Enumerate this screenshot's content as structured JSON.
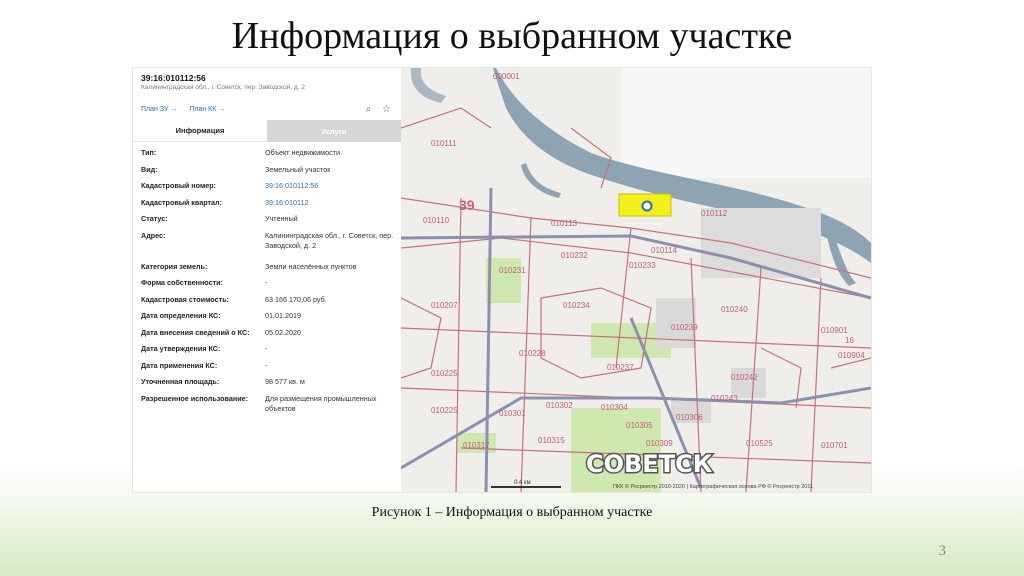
{
  "slide": {
    "title": "Информация о выбранном участке",
    "caption": "Рисунок 1 – Информация о выбранном участке",
    "page_number": "3"
  },
  "panel": {
    "cadastral_number": "39:16:010112:56",
    "address_line": "Калининградская обл., г. Советск, пер. Заводской, д. 2",
    "links": [
      "План ЗУ →",
      "План КК →"
    ],
    "icons": [
      "search-document-icon",
      "star-icon"
    ],
    "tabs": [
      {
        "label": "Информация",
        "active": true
      },
      {
        "label": "Услуги",
        "active": false
      }
    ],
    "rows": [
      {
        "key": "Тип:",
        "value": "Объект недвижимости"
      },
      {
        "key": "Вид:",
        "value": "Земельный участок"
      },
      {
        "key": "Кадастровый номер:",
        "value": "39:16:010112:56"
      },
      {
        "key": "Кадастровый квартал:",
        "value": "39:16:010112"
      },
      {
        "key": "Статус:",
        "value": "Учтенный"
      },
      {
        "key": "Адрес:",
        "value": "Калининградская обл., г. Советск, пер. Заводской, д. 2"
      },
      {
        "key": "Категория земель:",
        "value": "Земли населённых пунктов"
      },
      {
        "key": "Форма собственности:",
        "value": "-"
      },
      {
        "key": "Кадастровая стоимость:",
        "value": "63 166 170,06 руб."
      },
      {
        "key": "Дата определения КС:",
        "value": "01.01.2019"
      },
      {
        "key": "Дата внесения сведений о КС:",
        "value": "05.02.2020"
      },
      {
        "key": "Дата утверждения КС:",
        "value": "-"
      },
      {
        "key": "Дата применения КС:",
        "value": "-"
      },
      {
        "key": "Уточненная площадь:",
        "value": "98 577 кв. м"
      },
      {
        "key": "Разрешенное использование:",
        "value": "Для размещения промышленных объектов"
      }
    ]
  },
  "map": {
    "city_label": "СОВЕТСК",
    "region_label": "39",
    "scale_label": "0.4 км",
    "attribution": "ПКК © Росреестр 2010-2020 | Картографическая основа РФ © Росреестр 2011",
    "quarter_labels": [
      "000001",
      "010111",
      "010110",
      "010113",
      "010112",
      "010114",
      "010231",
      "010232",
      "010233",
      "010234",
      "010207",
      "010228",
      "010237",
      "010225",
      "010301",
      "010302",
      "010304",
      "010305",
      "010306",
      "010309",
      "010315",
      "010317",
      "010240",
      "010239",
      "010242",
      "010243",
      "010525",
      "010701",
      "010901",
      "010904",
      "16"
    ],
    "colors": {
      "parcel_highlight": "#f3ef1a",
      "river": "#8fa4b3",
      "boundary": "#c9707a",
      "road": "#8d8fb0",
      "green": "#cfe8b0"
    }
  }
}
